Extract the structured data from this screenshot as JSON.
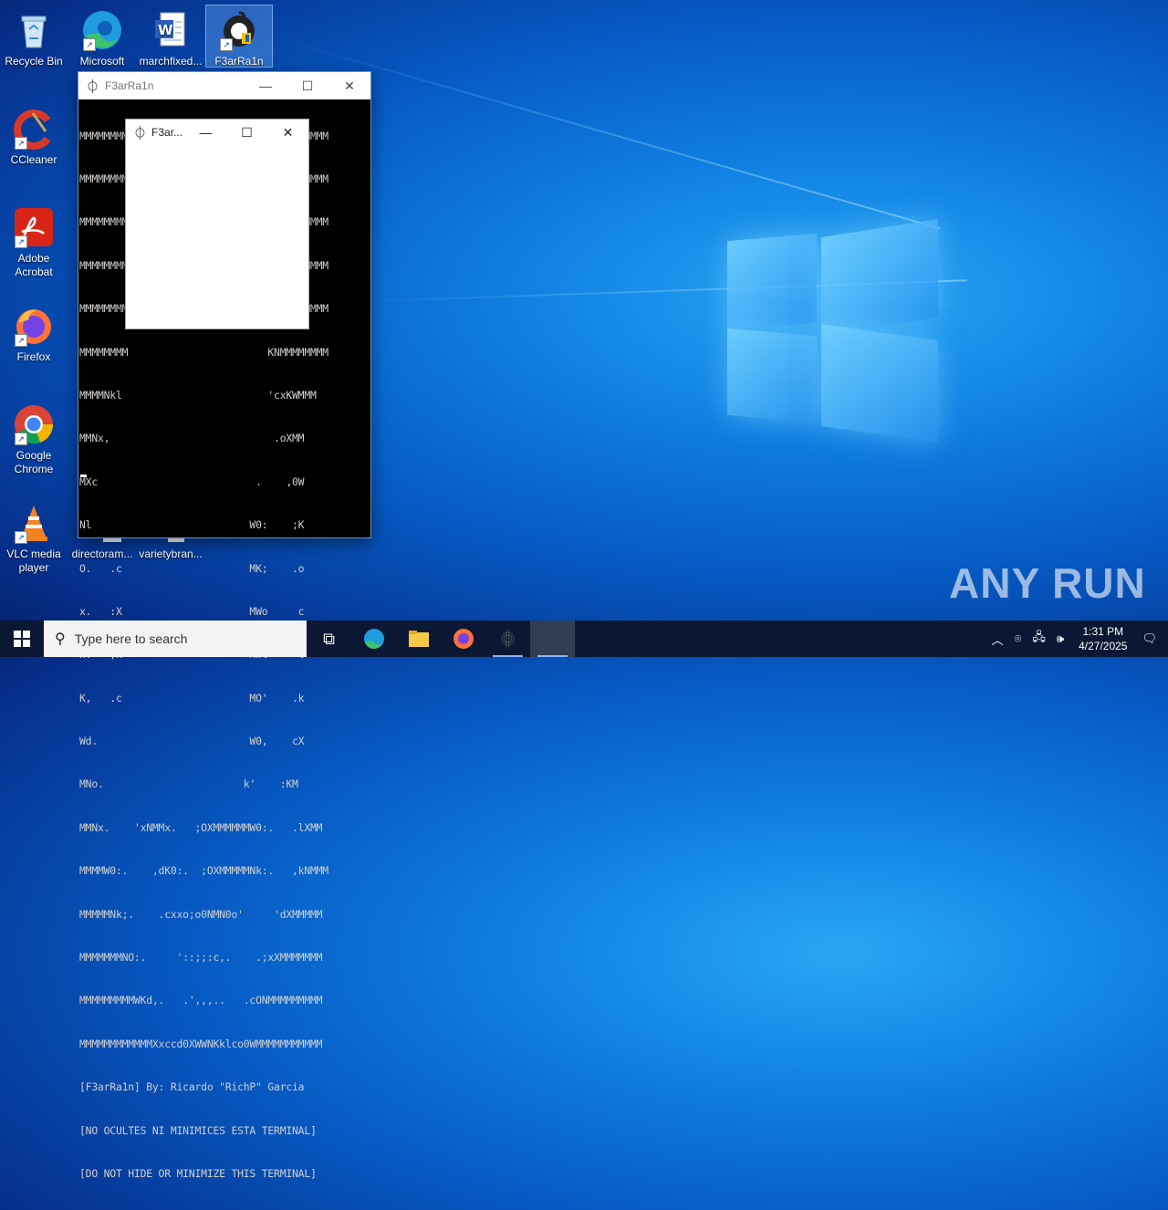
{
  "desktop": {
    "icons": [
      {
        "label": "Recycle Bin",
        "icon": "recycle-bin-icon"
      },
      {
        "label": "Microsoft Edge",
        "icon": "edge-icon"
      },
      {
        "label": "marchfixed...",
        "icon": "word-document-icon"
      },
      {
        "label": "F3arRa1n",
        "icon": "f3arra1n-icon"
      },
      {
        "label": "CCleaner",
        "icon": "ccleaner-icon"
      },
      {
        "label": "Adobe Acrobat",
        "icon": "acrobat-icon"
      },
      {
        "label": "Firefox",
        "icon": "firefox-icon"
      },
      {
        "label": "Google Chrome",
        "icon": "chrome-icon"
      },
      {
        "label": "VLC media player",
        "icon": "vlc-icon"
      },
      {
        "label": "directoram...",
        "icon": "file-icon"
      },
      {
        "label": "varietybran...",
        "icon": "file-icon"
      }
    ]
  },
  "console_window": {
    "title": "F3arRa1n",
    "lines": [
      "MMMMMMMMMMMMMMMMMMMMMMMMN0dc,:0MMMMMMMMMM",
      "MMMMMMMM                       0MMMMMMMMM",
      "MMMMMMMM                       MMMMMMMMMM",
      "MMMMMMMM                       MMMMMMMMMM",
      "MMMMMMMM                       NMMMMMMMMM",
      "MMMMMMMM                       KNMMMMMMMM",
      "MMMMNkl                        'cxKWMMM",
      "MMNx,                           .oXMM",
      "MXc                          .    ,0W",
      "Nl                          W0:    ;K",
      "O.   .c                     MK;    .o",
      "x.   :X                     MWo     c",
      "x.   ,K                     MWl     l",
      "K,   .c                     MO'    .k",
      "Wd.                         W0,    cX",
      "MNo.                       k'    :KM",
      "MMNx.    'xNMMx.   ;OXMMMMMMW0:.   .lXMM",
      "MMMMW0:.    ,dK0:.  ;OXMMMMMNk:.   ,kNMMM",
      "MMMMMNk;.    .cxxo;o0NMN0o'     'dXMMMMM",
      "MMMMMMMNO:.     '::;;:c,.    .;xXMMMMMMM",
      "MMMMMMMMMWKd,.   .',,,..   .cONMMMMMMMMM",
      "MMMMMMMMMMMMXxccd0XWWNKklco0WMMMMMMMMMMM",
      "[F3arRa1n] By: Ricardo \"RichP\" Garcia",
      "[NO OCULTES NI MINIMICES ESTA TERMINAL]",
      "[DO NOT HIDE OR MINIMIZE THIS TERMINAL]"
    ]
  },
  "popup_window": {
    "title": "F3ar..."
  },
  "watermark": "ANY RUN",
  "taskbar": {
    "search_placeholder": "Type here to search",
    "time": "1:31 PM",
    "date": "4/27/2025"
  }
}
